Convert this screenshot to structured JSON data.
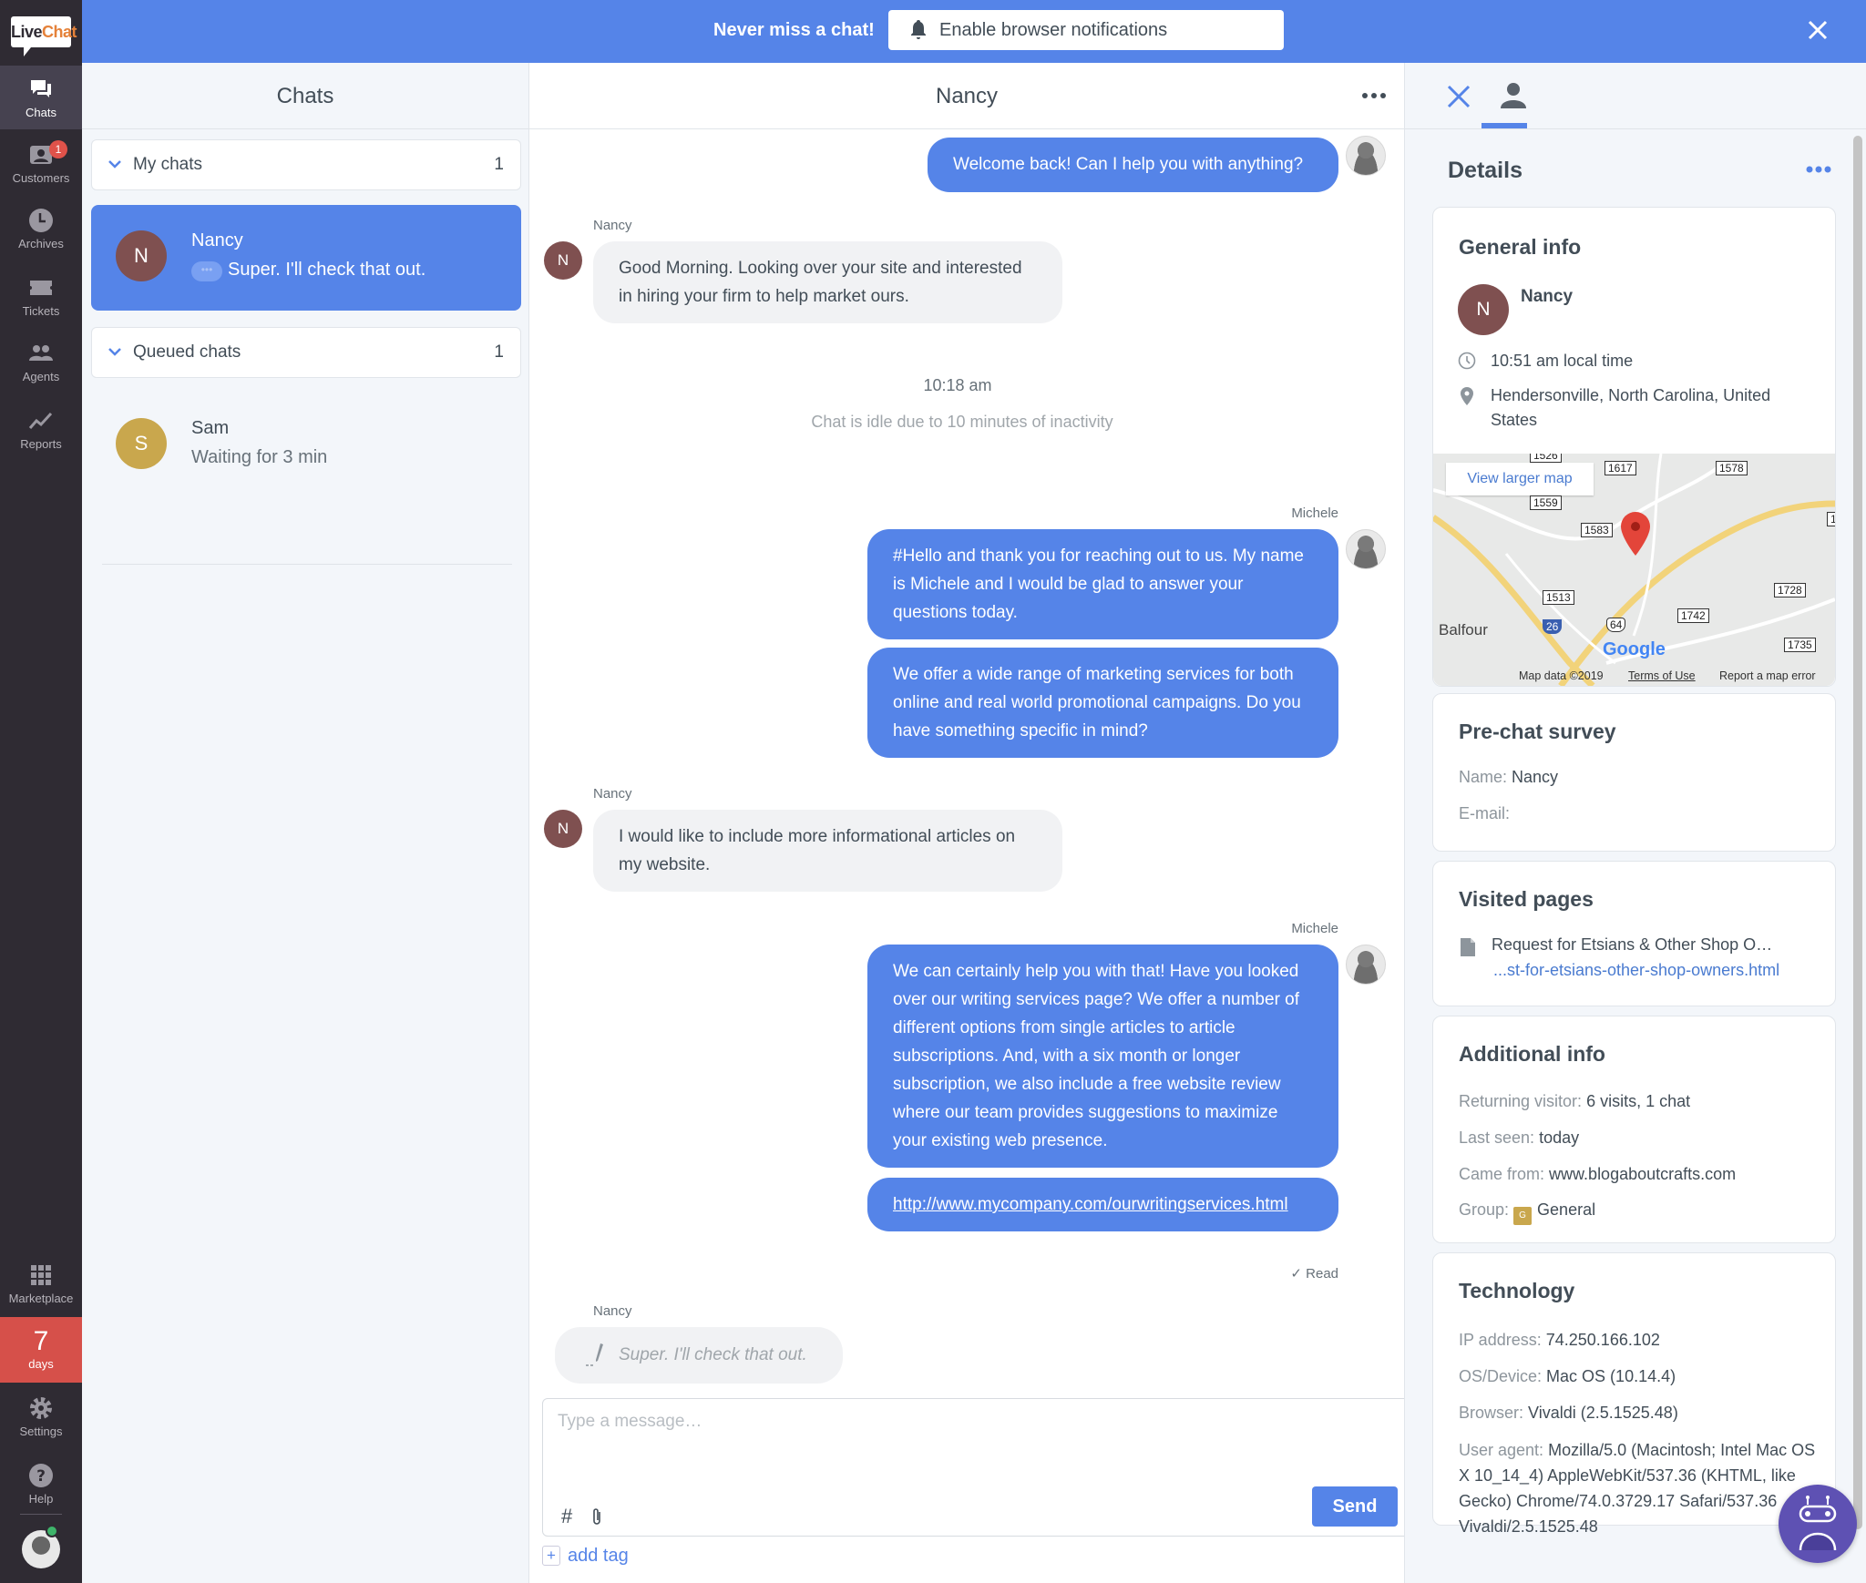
{
  "nav": {
    "logo": {
      "part1": "Live",
      "part2": "Chat"
    },
    "items": [
      {
        "label": "Chats",
        "icon": "chat-bubbles-icon",
        "active": true
      },
      {
        "label": "Customers",
        "icon": "customers-icon",
        "badge": "1"
      },
      {
        "label": "Archives",
        "icon": "clock-icon"
      },
      {
        "label": "Tickets",
        "icon": "ticket-icon"
      },
      {
        "label": "Agents",
        "icon": "agents-icon"
      },
      {
        "label": "Reports",
        "icon": "chart-line-icon"
      }
    ],
    "bottom": [
      {
        "label": "Marketplace",
        "icon": "grid-icon"
      },
      {
        "label": "Settings",
        "icon": "gear-icon"
      },
      {
        "label": "Help",
        "icon": "help-icon"
      }
    ],
    "trial": {
      "number": "7",
      "unit": "days"
    },
    "accent": "#d6504a"
  },
  "banner": {
    "text": "Never miss a chat!",
    "button": "Enable browser notifications",
    "color": "#5584e8"
  },
  "chats": {
    "title": "Chats",
    "my_chats": {
      "label": "My chats",
      "count": "1"
    },
    "queued_chats": {
      "label": "Queued chats",
      "count": "1"
    },
    "items": [
      {
        "initial": "N",
        "name": "Nancy",
        "preview": "Super. I'll check that out.",
        "typing": "•••",
        "avatar_color": "#7f5050"
      }
    ],
    "queued": [
      {
        "initial": "S",
        "name": "Sam",
        "status": "Waiting for 3 min",
        "avatar_color": "#c9a74d"
      }
    ]
  },
  "conversation": {
    "title": "Nancy",
    "messages": [
      {
        "from": "agent",
        "text": "Welcome back! Can I help you with anything?"
      },
      {
        "from": "visitor",
        "sender": "Nancy",
        "initial": "N",
        "text": "Good Morning. Looking over your site and interested in hiring your firm to help market ours."
      },
      {
        "from": "agent",
        "sender": "Michele",
        "text": "#Hello and thank you for reaching out to us. My name is Michele and I would be glad to answer your questions today."
      },
      {
        "from": "agent",
        "text": "We offer a wide range of marketing services for both online and real world promotional campaigns. Do you have something specific in mind?"
      },
      {
        "from": "visitor",
        "sender": "Nancy",
        "initial": "N",
        "text": "I would like to include more informational articles on my website."
      },
      {
        "from": "agent",
        "sender": "Michele",
        "text": "We can certainly help you with that! Have you looked over our writing services page? We offer a number of different options from single articles to article subscriptions. And, with a six month or longer subscription, we also include a free website review where our team provides suggestions to maximize your existing web presence."
      },
      {
        "from": "agent",
        "text": "http://www.mycompany.com/ourwritingservices.html",
        "link": true
      }
    ],
    "system": {
      "time": "10:18 am",
      "idle": "Chat is idle due to 10 minutes of inactivity"
    },
    "read_status": "Read",
    "typing": {
      "sender": "Nancy",
      "text": "Super. I'll check that out."
    },
    "composer": {
      "placeholder": "Type a message…",
      "send": "Send",
      "hash": "#"
    },
    "add_tag": "add tag"
  },
  "details": {
    "title": "Details",
    "general": {
      "title": "General info",
      "initial": "N",
      "name": "Nancy",
      "local_time": "10:51 am local time",
      "location": "Hendersonville, North Carolina, United States"
    },
    "map": {
      "view_larger": "View larger map",
      "town": "Balfour",
      "roads": [
        "1526",
        "1617",
        "1578",
        "1559",
        "1583",
        "1513",
        "1728",
        "1742",
        "1735",
        "1"
      ],
      "interstate": "26",
      "highway": "64",
      "provider": "Google",
      "footer": [
        "Map data ©2019",
        "Terms of Use",
        "Report a map error"
      ]
    },
    "prechat": {
      "title": "Pre-chat survey",
      "name_label": "Name:",
      "name": "Nancy",
      "email_label": "E-mail:",
      "email": ""
    },
    "visited": {
      "title": "Visited pages",
      "page_title": "Request for Etsians & Other Shop O…",
      "page_url": "...st-for-etsians-other-shop-owners.html"
    },
    "additional": {
      "title": "Additional info",
      "returning_label": "Returning visitor:",
      "returning": "6 visits, 1 chat",
      "last_seen_label": "Last seen:",
      "last_seen": "today",
      "came_from_label": "Came from:",
      "came_from": "www.blogaboutcrafts.com",
      "group_label": "Group:",
      "group_initial": "G",
      "group": "General"
    },
    "technology": {
      "title": "Technology",
      "ip_label": "IP address:",
      "ip": "74.250.166.102",
      "os_label": "OS/Device:",
      "os": "Mac OS (10.14.4)",
      "browser_label": "Browser:",
      "browser": "Vivaldi (2.5.1525.48)",
      "ua_label": "User agent:",
      "ua": "Mozilla/5.0 (Macintosh; Intel Mac OS X 10_14_4) AppleWebKit/537.36 (KHTML, like Gecko) Chrome/74.0.3729.17 Safari/537.36 Vivaldi/2.5.1525.48"
    }
  }
}
